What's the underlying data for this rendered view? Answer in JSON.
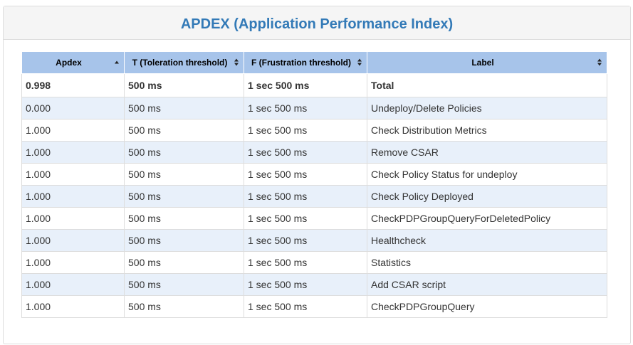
{
  "title": "APDEX (Application Performance Index)",
  "columns": [
    {
      "label": "Apdex",
      "sort": "asc"
    },
    {
      "label": "T (Toleration threshold)",
      "sort": "both"
    },
    {
      "label": "F (Frustration threshold)",
      "sort": "both"
    },
    {
      "label": "Label",
      "sort": "both"
    }
  ],
  "total_row": {
    "apdex": "0.998",
    "t": "500 ms",
    "f": "1 sec 500 ms",
    "label": "Total"
  },
  "rows": [
    {
      "apdex": "0.000",
      "t": "500 ms",
      "f": "1 sec 500 ms",
      "label": "Undeploy/Delete Policies"
    },
    {
      "apdex": "1.000",
      "t": "500 ms",
      "f": "1 sec 500 ms",
      "label": "Check Distribution Metrics"
    },
    {
      "apdex": "1.000",
      "t": "500 ms",
      "f": "1 sec 500 ms",
      "label": "Remove CSAR"
    },
    {
      "apdex": "1.000",
      "t": "500 ms",
      "f": "1 sec 500 ms",
      "label": "Check Policy Status for undeploy"
    },
    {
      "apdex": "1.000",
      "t": "500 ms",
      "f": "1 sec 500 ms",
      "label": "Check Policy Deployed"
    },
    {
      "apdex": "1.000",
      "t": "500 ms",
      "f": "1 sec 500 ms",
      "label": "CheckPDPGroupQueryForDeletedPolicy"
    },
    {
      "apdex": "1.000",
      "t": "500 ms",
      "f": "1 sec 500 ms",
      "label": "Healthcheck"
    },
    {
      "apdex": "1.000",
      "t": "500 ms",
      "f": "1 sec 500 ms",
      "label": "Statistics"
    },
    {
      "apdex": "1.000",
      "t": "500 ms",
      "f": "1 sec 500 ms",
      "label": "Add CSAR script"
    },
    {
      "apdex": "1.000",
      "t": "500 ms",
      "f": "1 sec 500 ms",
      "label": "CheckPDPGroupQuery"
    }
  ],
  "colors": {
    "title": "#337ab7",
    "header_bg": "#a7c4ea",
    "stripe_bg": "#e8f0fa",
    "heading_bg": "#f5f5f5"
  }
}
